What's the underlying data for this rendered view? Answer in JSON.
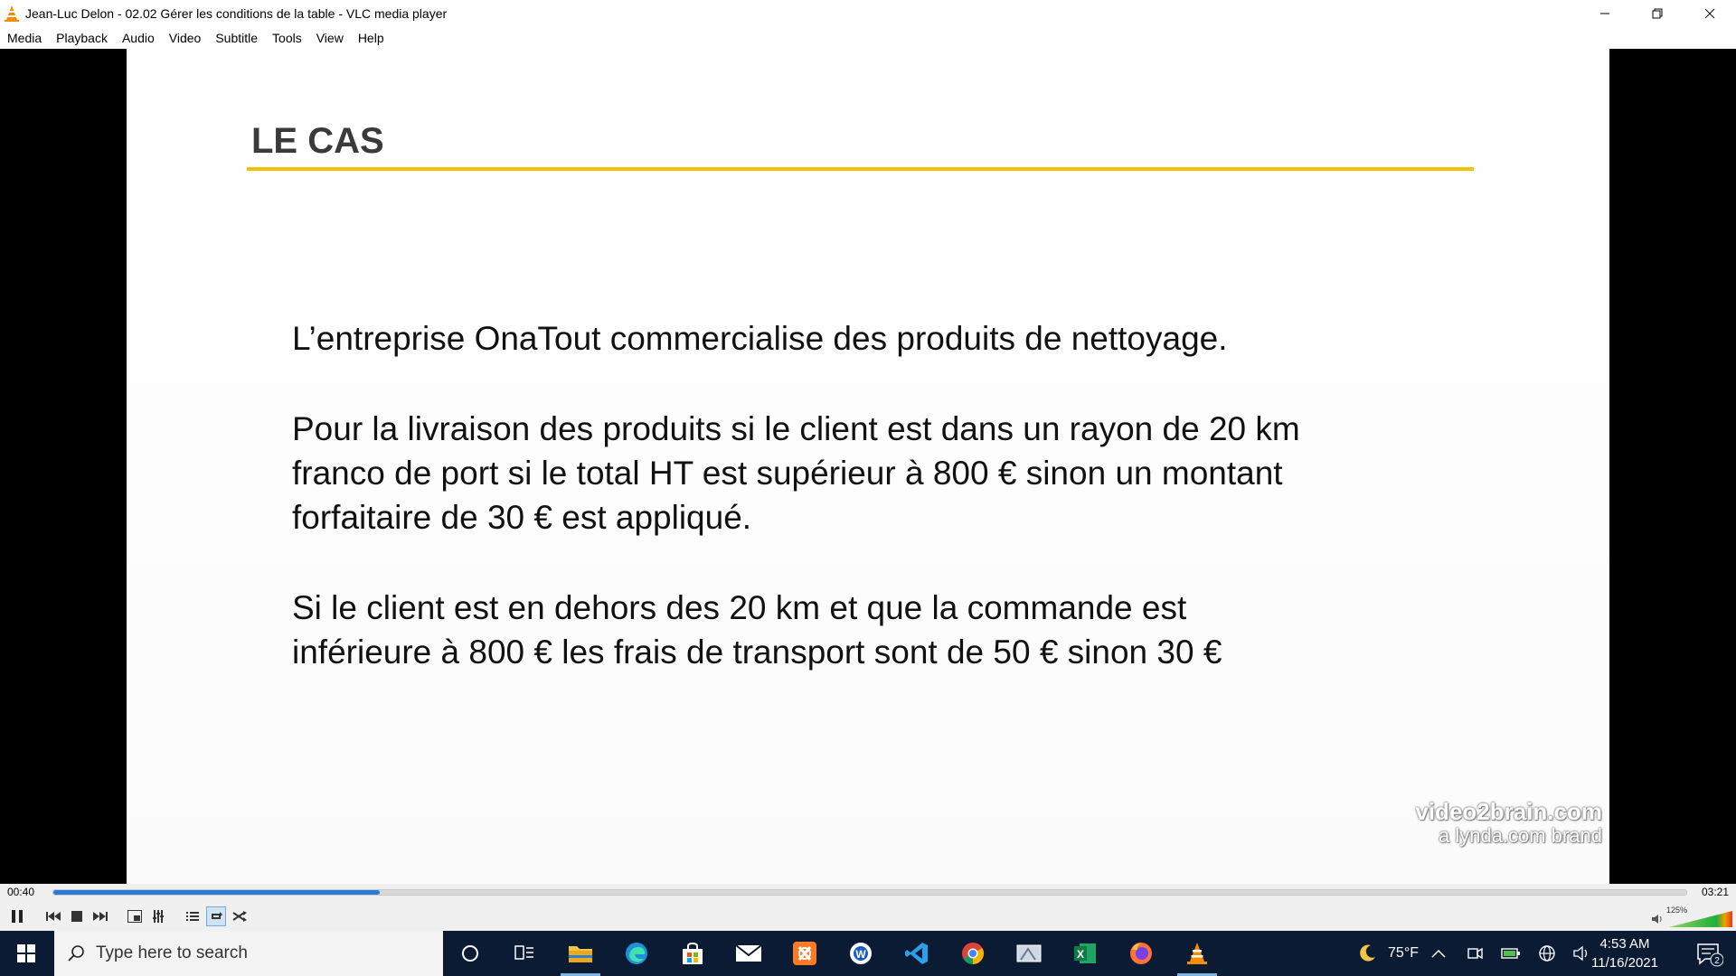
{
  "window": {
    "title": "Jean-Luc Delon - 02.02 Gérer les conditions de la table - VLC media player"
  },
  "menu": [
    "Media",
    "Playback",
    "Audio",
    "Video",
    "Subtitle",
    "Tools",
    "View",
    "Help"
  ],
  "slide": {
    "heading": "LE CAS",
    "para1": "L’entreprise OnaTout commercialise des produits de nettoyage.",
    "para2_lines": [
      "Pour la livraison des produits si le client est dans un rayon de 20 km",
      "franco de port si le total HT est supérieur à 800 € sinon un montant",
      "forfaitaire de 30 € est appliqué."
    ],
    "para3_lines": [
      "Si le client est en dehors des 20 km et que la commande est",
      "inférieure à 800 € les frais de transport sont de 50 € sinon 30 €"
    ],
    "watermark_line1": "video2brain.com",
    "watermark_line2": "a lynda.com brand"
  },
  "player": {
    "elapsed": "00:40",
    "total": "03:21",
    "progress_fraction": 0.2,
    "volume_label": "125%",
    "volume_fraction": 1.0
  },
  "taskbar": {
    "search_placeholder": "Type here to search",
    "weather": "75°F",
    "time": "4:53 AM",
    "date": "11/16/2021",
    "notification_count": "2"
  },
  "colors": {
    "accent_rule": "#f2c200",
    "seek_fill": "#2a7bd8",
    "taskbar_bg": "#0b1b33"
  }
}
